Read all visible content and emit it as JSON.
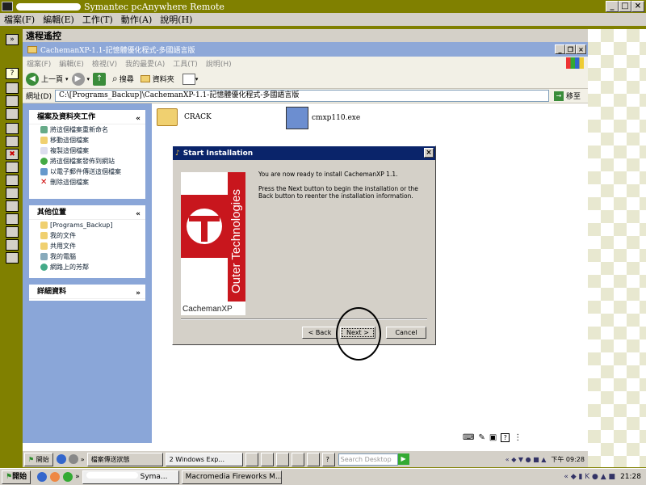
{
  "outer": {
    "title": "Symantec pcAnywhere Remote",
    "menu": [
      "檔案(F)",
      "編輯(E)",
      "工作(T)",
      "動作(A)",
      "說明(H)"
    ]
  },
  "remote_caption": "遠程遙控",
  "explorer": {
    "title": "CachemanXP-1.1-記憶體優化程式-多國語言版",
    "menu": [
      "檔案(F)",
      "編輯(E)",
      "檢視(V)",
      "我的最愛(A)",
      "工具(T)",
      "說明(H)"
    ],
    "toolbar": {
      "back": "上一頁",
      "search": "搜尋",
      "folders": "資料夾"
    },
    "address_label": "網址(D)",
    "address_value": "C:\\[Programs_Backup]\\CachemanXP-1.1-記憶體優化程式-多國語言版",
    "go_label": "移至",
    "tasks_title": "檔案及資料夾工作",
    "tasks": [
      "將這個檔案重新命名",
      "移動這個檔案",
      "複製這個檔案",
      "將這個檔案發佈到網站",
      "以電子郵件傳送這個檔案",
      "刪除這個檔案"
    ],
    "places_title": "其他位置",
    "places": [
      "[Programs_Backup]",
      "我的文件",
      "共用文件",
      "我的電腦",
      "網路上的芳鄰"
    ],
    "details_title": "詳細資料",
    "files": [
      {
        "name": "CRACK"
      },
      {
        "name": "cmxp110.exe"
      }
    ]
  },
  "dialog": {
    "title": "Start Installation",
    "line1": "You are now ready to install CachemanXP 1.1.",
    "line2": "Press the Next button to begin the installation or the Back button to reenter the installation information.",
    "logo_vertical": "Outer Technologies",
    "logo_product": "CachemanXP",
    "back_label": "< Back",
    "next_label": "Next >",
    "cancel_label": "Cancel"
  },
  "remote_taskbar": {
    "start": "開始",
    "task1": "檔案傳送狀態",
    "task2": "2 Windows Exp...",
    "search_placeholder": "Search Desktop",
    "clock": "下午 09:28"
  },
  "host_taskbar": {
    "start": "開始",
    "task1": "Syma...",
    "task2": "Macromedia Fireworks M...",
    "clock": "21:28"
  },
  "colors": {
    "olive": "#808000",
    "xp_blue": "#8aa6d8",
    "dialog_title": "#0a246a",
    "logo_red": "#c8161d"
  }
}
